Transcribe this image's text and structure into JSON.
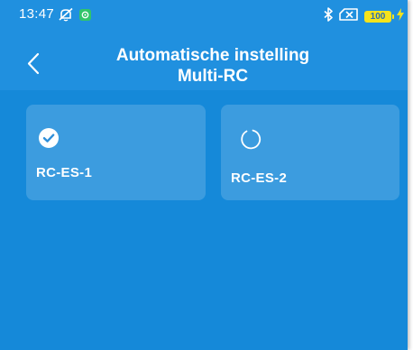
{
  "status_bar": {
    "time": "13:47",
    "battery": "100",
    "icons": [
      "notifications-off-icon",
      "app-notification-icon",
      "bluetooth-icon",
      "no-sim-icon",
      "battery-icon",
      "charging-icon"
    ]
  },
  "header": {
    "back_icon": "chevron-left-icon",
    "title_line1": "Automatische instelling",
    "title_line2": "Multi-RC"
  },
  "devices": [
    {
      "label": "RC-ES-1",
      "icon": "check-circle-icon",
      "state": "done"
    },
    {
      "label": "RC-ES-2",
      "icon": "loading-spinner-icon",
      "state": "in-progress"
    }
  ],
  "colors": {
    "background": "#1589d9",
    "header": "#2090df",
    "text": "#ffffff",
    "battery": "#f6e31b"
  }
}
